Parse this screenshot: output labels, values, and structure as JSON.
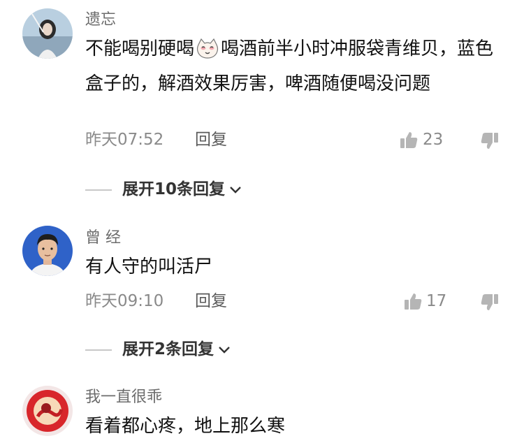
{
  "comments": [
    {
      "username": "遗忘",
      "text_before_emoji": "不能喝别硬喝",
      "emoji": "cat-face-emoji",
      "text_after_emoji": "喝酒前半小时冲服袋青维贝，蓝色盒子的，解酒效果厉害，啤酒随便喝没问题",
      "time": "昨天07:52",
      "reply_label": "回复",
      "likes": "23",
      "expand_label": "展开10条回复"
    },
    {
      "username": "曾 经",
      "text": "有人守的叫活尸",
      "time": "昨天09:10",
      "reply_label": "回复",
      "likes": "17",
      "expand_label": "展开2条回复"
    },
    {
      "username": "我一直很乖",
      "text": "看着都心疼，地上那么寒"
    }
  ],
  "colors": {
    "username": "#6c6c6c",
    "text": "#111111",
    "meta": "#8a8a8a",
    "avatar3_red": "#d8262b"
  }
}
